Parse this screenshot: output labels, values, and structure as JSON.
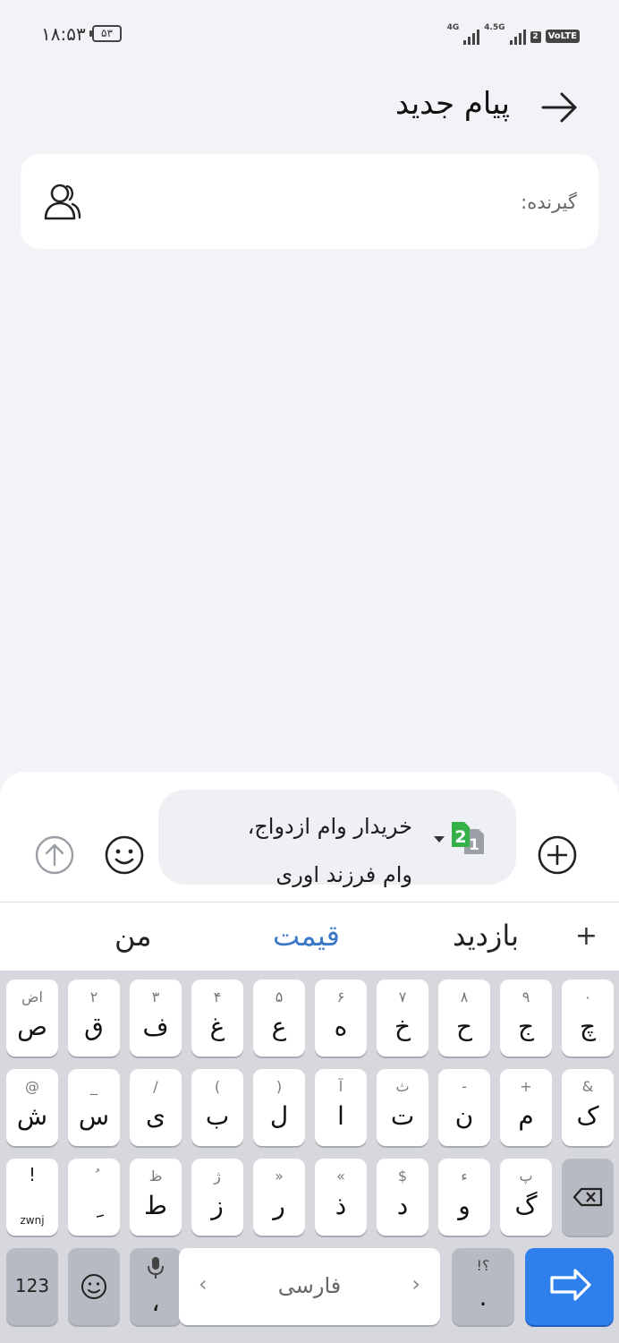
{
  "status_bar": {
    "time": "۱۸:۵۳",
    "battery": "۵۳",
    "signal1_label": "4G",
    "signal2_label": "4.5G",
    "sim_badge": "2",
    "volte": "VoLTE"
  },
  "header": {
    "title": "پیام جدید",
    "back_icon": "arrow-right-icon"
  },
  "recipient": {
    "label": "گیرنده:",
    "contacts_icon": "contacts-icon"
  },
  "compose": {
    "message_line1": "خریدار وام ازدواج،",
    "message_line2": "وام فرزند اوری",
    "sim_number_front": "2",
    "sim_number_back": "1",
    "attach_icon": "plus-circle-icon",
    "emoji_icon": "smiley-icon",
    "send_icon": "send-arrow-icon"
  },
  "suggestions": {
    "plus": "+",
    "items": [
      "بازدید",
      "قیمت",
      "من"
    ]
  },
  "keyboard": {
    "row1": [
      {
        "main": "چ",
        "sub": "۰"
      },
      {
        "main": "ج",
        "sub": "۹"
      },
      {
        "main": "ح",
        "sub": "۸"
      },
      {
        "main": "خ",
        "sub": "۷"
      },
      {
        "main": "ه",
        "sub": "۶"
      },
      {
        "main": "ع",
        "sub": "۵"
      },
      {
        "main": "غ",
        "sub": "۴"
      },
      {
        "main": "ف",
        "sub": "۳"
      },
      {
        "main": "ق",
        "sub": "۲"
      },
      {
        "main": "ص",
        "sub": "اض"
      }
    ],
    "row2": [
      {
        "main": "ک",
        "sub": "&"
      },
      {
        "main": "م",
        "sub": "+"
      },
      {
        "main": "ن",
        "sub": "-"
      },
      {
        "main": "ت",
        "sub": "ث"
      },
      {
        "main": "ا",
        "sub": "آ"
      },
      {
        "main": "ل",
        "sub": ")"
      },
      {
        "main": "ب",
        "sub": "("
      },
      {
        "main": "ی",
        "sub": "/"
      },
      {
        "main": "س",
        "sub": "_"
      },
      {
        "main": "ش",
        "sub": "@"
      }
    ],
    "row3": [
      {
        "main": "گ",
        "sub": "پ"
      },
      {
        "main": "و",
        "sub": "ء"
      },
      {
        "main": "د",
        "sub": "$"
      },
      {
        "main": "ذ",
        "sub": "«"
      },
      {
        "main": "ر",
        "sub": "»"
      },
      {
        "main": "ز",
        "sub": "ژ"
      },
      {
        "main": "ط",
        "sub": "ظ"
      },
      {
        "main": "ِ",
        "sub": "ُ"
      }
    ],
    "zwnj_label": "zwnj",
    "numbers_label": "123",
    "comma": "،",
    "space_label": "فارسی",
    "period": ".",
    "period_sub": "!؟",
    "backspace_icon": "backspace-icon",
    "enter_icon": "enter-arrow-icon"
  }
}
